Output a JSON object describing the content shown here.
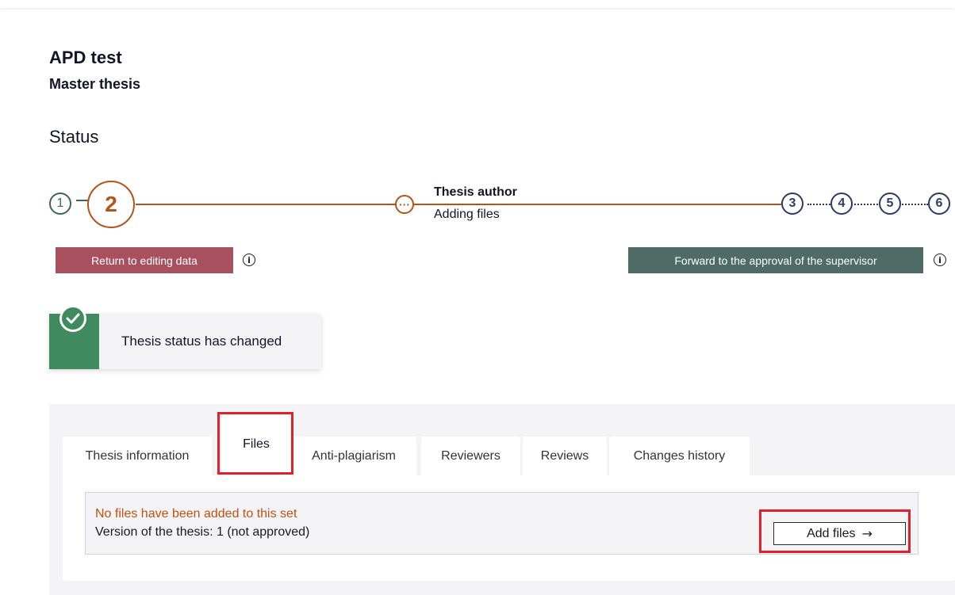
{
  "header": {
    "title": "APD test",
    "subtitle": "Master thesis"
  },
  "status": {
    "heading": "Status",
    "steps": [
      "1",
      "2",
      "3",
      "4",
      "5",
      "6"
    ],
    "current_step": "2",
    "substep_icon": "ellipsis-icon",
    "role": "Thesis author",
    "action": "Adding files",
    "return_button": "Return to editing data",
    "forward_button": "Forward to the approval of the supervisor",
    "info_glyph": "i"
  },
  "notification": {
    "icon": "check-circle-icon",
    "message": "Thesis status has changed"
  },
  "tabs": [
    {
      "label": "Thesis information",
      "active": false
    },
    {
      "label": "Files",
      "active": true
    },
    {
      "label": "Anti-plagiarism",
      "active": false
    },
    {
      "label": "Reviewers",
      "active": false
    },
    {
      "label": "Reviews",
      "active": false
    },
    {
      "label": "Changes history",
      "active": false
    }
  ],
  "files": {
    "empty_message": "No files have been added to this set",
    "version_text": "Version of the thesis: 1 (not approved)",
    "add_button": "Add files",
    "add_arrow": "→"
  },
  "colors": {
    "current_step": "#b5541a",
    "future_step": "#2f3a66",
    "done_step": "#3a6b50",
    "return_button": "#a8505e",
    "forward_button": "#4e6b66",
    "success": "#3f8a5e",
    "warning_text": "#c0510f",
    "highlight": "#e0202a"
  }
}
